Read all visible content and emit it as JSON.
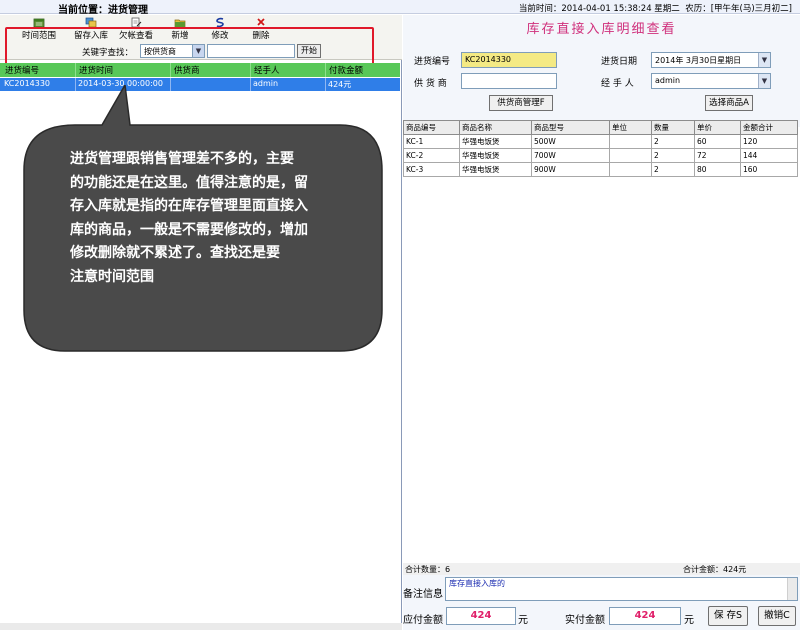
{
  "header": {
    "location": "当前位置：进货管理",
    "datetime": "当前时间：2014-04-01 15:38:24 星期二",
    "lunar": "农历：[甲午年(马)三月初二]"
  },
  "toolbar": {
    "time_range": "时间范围",
    "retained_stock": "留存入库",
    "debt_view": "欠帐查看",
    "add": "新增",
    "edit": "修改",
    "delete": "删除"
  },
  "search": {
    "keyword_label": "关键字查找：",
    "field_selected": "按供货商",
    "keyword_value": "",
    "start": "开始"
  },
  "left_grid": {
    "columns": [
      "进货编号",
      "进货时间",
      "供货商",
      "经手人",
      "付款金额"
    ],
    "rows": [
      [
        "KC2014330",
        "2014-03-30 00:00:00",
        "",
        "admin",
        "424元"
      ]
    ]
  },
  "callout": {
    "lines": [
      "进货管理跟销售管理差不多的，主要",
      "的功能还是在这里。值得注意的是，留",
      "存入库就是指的在库存管理里面直接入",
      "库的商品，一般是不需要修改的，增加",
      "修改删除就不累述了。查找还是要",
      "注意时间范围"
    ]
  },
  "detail": {
    "title": "库存直接入库明细查看",
    "order_no_label": "进货编号",
    "order_no": "KC2014330",
    "date_label": "进货日期",
    "date": "2014年 3月30日星期日",
    "supplier_label": "供 货 商",
    "supplier": "",
    "handler_label": "经 手 人",
    "handler": "admin",
    "supplier_mgmt": "供货商管理F",
    "choose_goods": "选择商品A"
  },
  "goods_table": {
    "columns": [
      "商品编号",
      "商品名称",
      "商品型号",
      "单位",
      "数量",
      "单价",
      "金额合计"
    ],
    "rows": [
      [
        "KC-1",
        "华强电饭煲",
        "500W",
        "",
        "2",
        "60",
        "120"
      ],
      [
        "KC-2",
        "华强电饭煲",
        "700W",
        "",
        "2",
        "72",
        "144"
      ],
      [
        "KC-3",
        "华强电饭煲",
        "900W",
        "",
        "2",
        "80",
        "160"
      ]
    ]
  },
  "totals": {
    "count": "合计数量：6",
    "amount": "合计金额：424元"
  },
  "remarks": {
    "label": "备注信息",
    "value": "库存直接入库的"
  },
  "payment": {
    "payable_label": "应付金额",
    "payable": "424",
    "unit1": "元",
    "paid_label": "实付金额",
    "paid": "424",
    "unit2": "元",
    "save": "保 存S",
    "cancel": "撤销C"
  }
}
